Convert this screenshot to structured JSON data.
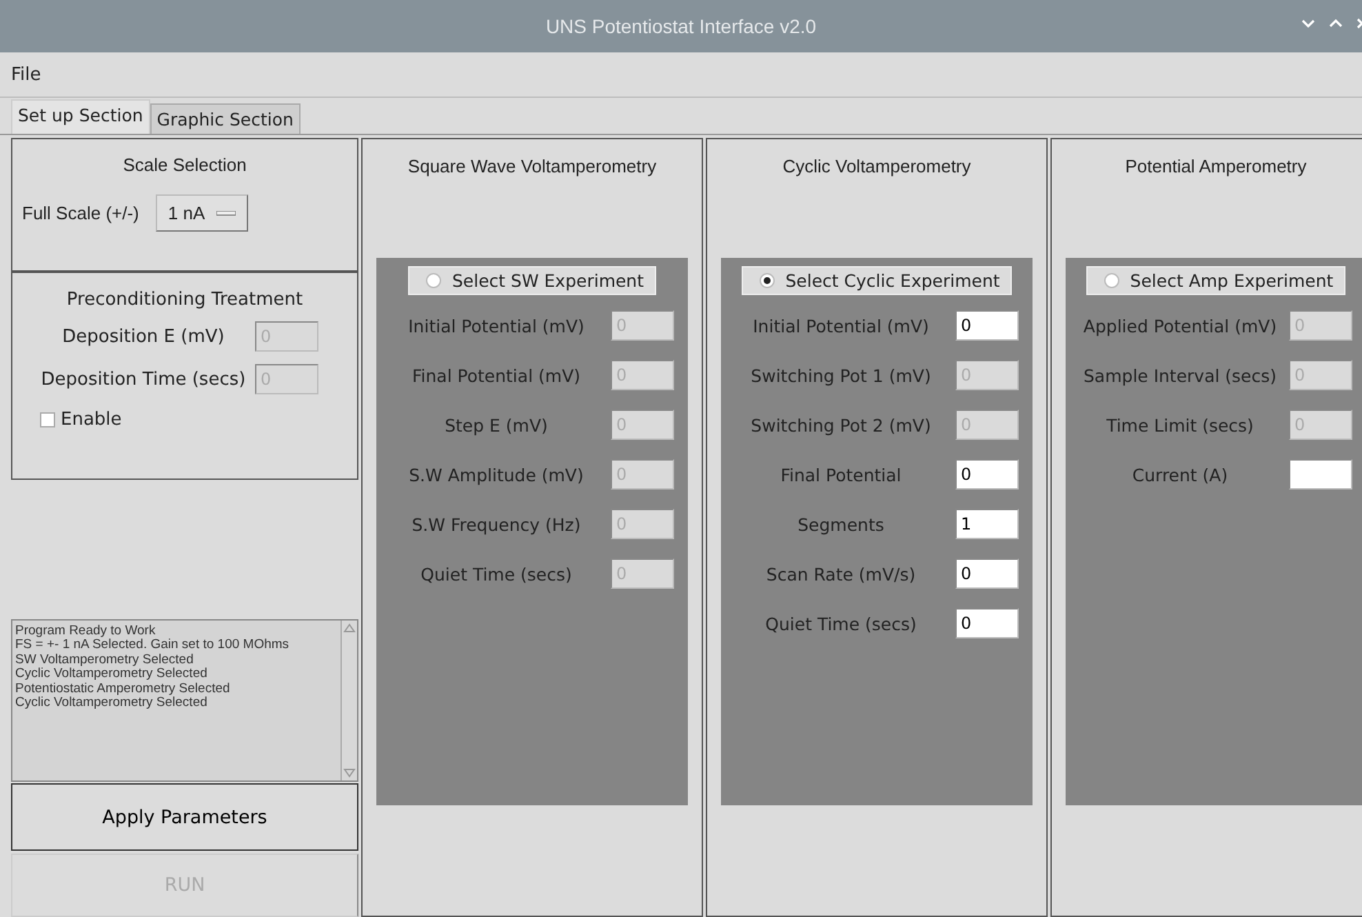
{
  "window": {
    "title": "UNS Potentiostat Interface v2.0"
  },
  "menu": [
    "File"
  ],
  "tabs": [
    {
      "label": "Set up Section",
      "selected": true
    },
    {
      "label": "Graphic Section",
      "selected": false
    }
  ],
  "scale_selection": {
    "title": "Scale Selection",
    "label": "Full Scale (+/-)",
    "value": "1 nA"
  },
  "preconditioning": {
    "title": "Preconditioning Treatment",
    "fields": [
      {
        "label": "Deposition E (mV)",
        "value": "0",
        "disabled": true
      },
      {
        "label": "Deposition Time (secs)",
        "value": "0",
        "disabled": true
      }
    ],
    "enable": {
      "label": "Enable",
      "checked": false
    }
  },
  "log": [
    "Program Ready to Work",
    "FS = +- 1 nA Selected. Gain set to 100 MOhms",
    "SW Voltamperometry Selected",
    "Cyclic Voltamperometry Selected",
    "Potentiostatic Amperometry Selected",
    "Cyclic Voltamperometry Selected"
  ],
  "buttons": [
    {
      "label": "Apply Parameters",
      "disabled": false
    },
    {
      "label": "RUN",
      "disabled": true
    }
  ],
  "experiments": [
    {
      "title": "Square Wave Voltamperometry",
      "select": {
        "label": "Select SW Experiment",
        "selected": false
      },
      "fields": [
        {
          "label": "Initial Potential (mV)",
          "value": "0",
          "disabled": true
        },
        {
          "label": "Final Potential (mV)",
          "value": "0",
          "disabled": true
        },
        {
          "label": "Step E (mV)",
          "value": "0",
          "disabled": true
        },
        {
          "label": "S.W Amplitude (mV)",
          "value": "0",
          "disabled": true
        },
        {
          "label": "S.W Frequency (Hz)",
          "value": "0",
          "disabled": true
        },
        {
          "label": "Quiet Time (secs)",
          "value": "0",
          "disabled": true
        }
      ]
    },
    {
      "title": "Cyclic Voltamperometry",
      "select": {
        "label": "Select Cyclic Experiment",
        "selected": true
      },
      "fields": [
        {
          "label": "Initial Potential (mV)",
          "value": "0",
          "disabled": false
        },
        {
          "label": "Switching Pot 1 (mV)",
          "value": "0",
          "disabled": true
        },
        {
          "label": "Switching Pot 2 (mV)",
          "value": "0",
          "disabled": true
        },
        {
          "label": "Final Potential",
          "value": "0",
          "disabled": false
        },
        {
          "label": "Segments",
          "value": "1",
          "disabled": false
        },
        {
          "label": "Scan Rate (mV/s)",
          "value": "0",
          "disabled": false
        },
        {
          "label": "Quiet Time (secs)",
          "value": "0",
          "disabled": false
        }
      ]
    },
    {
      "title": "Potential Amperometry",
      "select": {
        "label": "Select Amp Experiment",
        "selected": false
      },
      "fields": [
        {
          "label": "Applied Potential (mV)",
          "value": "0",
          "disabled": true
        },
        {
          "label": "Sample Interval (secs)",
          "value": "0",
          "disabled": true
        },
        {
          "label": "Time Limit (secs)",
          "value": "0",
          "disabled": true
        },
        {
          "label": "Current (A)",
          "disabled": false
        }
      ]
    }
  ]
}
